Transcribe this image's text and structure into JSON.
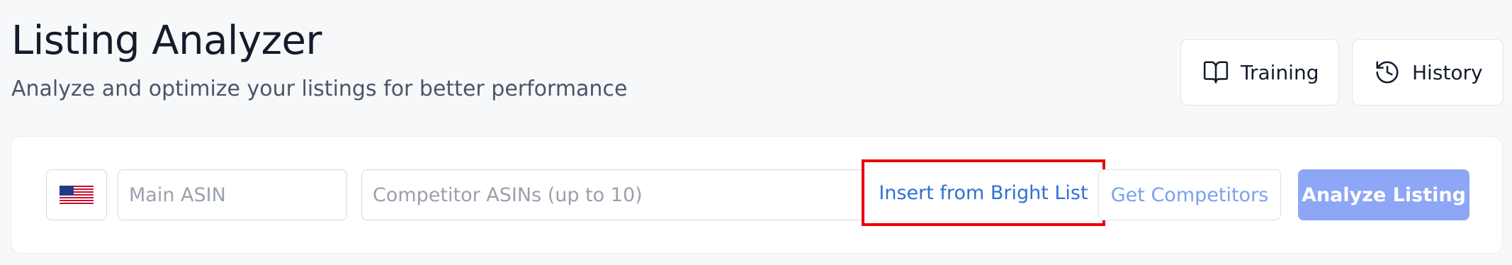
{
  "header": {
    "title": "Listing Analyzer",
    "subtitle": "Analyze and optimize your listings for better performance",
    "training_label": "Training",
    "history_label": "History"
  },
  "icons": {
    "training": "book-open-icon",
    "history": "history-clock-icon",
    "flag": "us-flag-icon"
  },
  "form": {
    "main_asin_placeholder": "Main ASIN",
    "main_asin_value": "",
    "competitor_placeholder": "Competitor ASINs (up to 10)",
    "competitor_value": "",
    "insert_label": "Insert from Bright List",
    "get_competitors_label": "Get Competitors",
    "analyze_label": "Analyze Listing"
  },
  "colors": {
    "highlight": "#e8000b",
    "link": "#2f6fd6",
    "primary_disabled": "#8ea6f6"
  }
}
